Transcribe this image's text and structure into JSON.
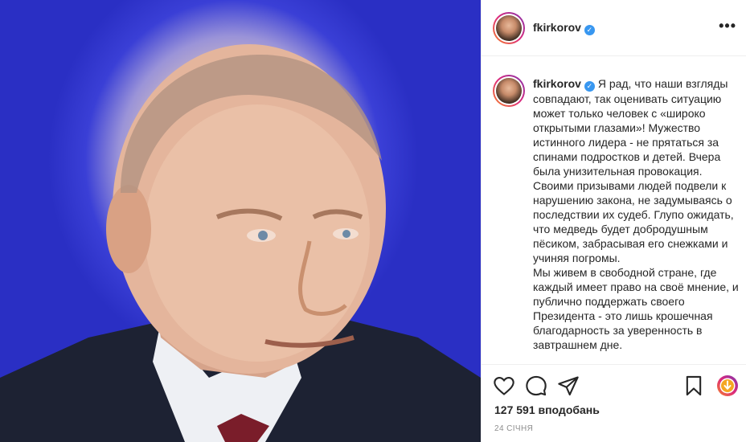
{
  "post": {
    "author": "fkirkorov",
    "verified_mark": "✓",
    "more_label": "•••",
    "caption_author": "fkirkorov",
    "caption_text": "Я рад, что наши взгляды совпадают, так оценивать ситуацию может только человек с «широко открытыми глазами»! Мужество истинного лидера - не прятаться за спинами подростков и детей. Вчера была унизительная провокация. Своими призывами людей подвели к нарушению закона, не задумываясь о последствии их судеб. Глупо ожидать, что медведь будет добродушным пёсиком, забрасывая его снежками и учиняя погромы.\nМы живем в свободной стране, где каждый имеет право на своё мнение, и публично поддержать своего Президента - это лишь крошечная благодарность за уверенность в завтрашнем дне.",
    "likes": "127 591 вподобань",
    "date": "24 СІЧНЯ"
  },
  "icons": {
    "like": "heart-icon",
    "comment": "comment-icon",
    "share": "share-icon",
    "save": "bookmark-icon",
    "download": "download-icon",
    "more": "more-icon"
  },
  "colors": {
    "verified": "#3897f0",
    "text": "#262626",
    "muted": "#8e8e8e",
    "download_gradient": [
      "#f58529",
      "#dd2a7b",
      "#8134af"
    ]
  }
}
